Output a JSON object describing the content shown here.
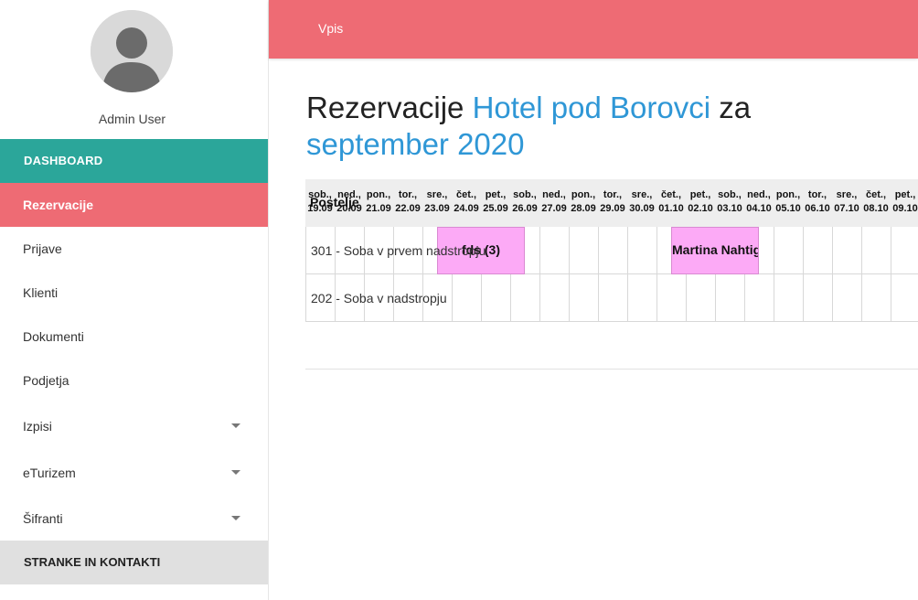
{
  "sidebar": {
    "user_name": "Admin User",
    "dashboard_label": "DASHBOARD",
    "items": [
      {
        "label": "Rezervacije"
      },
      {
        "label": "Prijave"
      },
      {
        "label": "Klienti"
      },
      {
        "label": "Dokumenti"
      },
      {
        "label": "Podjetja"
      },
      {
        "label": "Izpisi"
      },
      {
        "label": "eTurizem"
      },
      {
        "label": "Šifranti"
      }
    ],
    "section_label": "STRANKE IN KONTAKTI"
  },
  "topbar": {
    "link_label": "Vpis"
  },
  "title": {
    "prefix": "Rezervacije",
    "hotel": "Hotel pod Borovci",
    "connector": "za",
    "period": "september 2020"
  },
  "calendar": {
    "first_column_label": "Postelje",
    "days": [
      {
        "dow": "sob.,",
        "date": "19.09"
      },
      {
        "dow": "ned.,",
        "date": "20.09"
      },
      {
        "dow": "pon.,",
        "date": "21.09"
      },
      {
        "dow": "tor.,",
        "date": "22.09"
      },
      {
        "dow": "sre.,",
        "date": "23.09"
      },
      {
        "dow": "čet.,",
        "date": "24.09"
      },
      {
        "dow": "pet.,",
        "date": "25.09"
      },
      {
        "dow": "sob.,",
        "date": "26.09"
      },
      {
        "dow": "ned.,",
        "date": "27.09"
      },
      {
        "dow": "pon.,",
        "date": "28.09"
      },
      {
        "dow": "tor.,",
        "date": "29.09"
      },
      {
        "dow": "sre.,",
        "date": "30.09"
      },
      {
        "dow": "čet.,",
        "date": "01.10"
      },
      {
        "dow": "pet.,",
        "date": "02.10"
      },
      {
        "dow": "sob.,",
        "date": "03.10"
      },
      {
        "dow": "ned.,",
        "date": "04.10"
      },
      {
        "dow": "pon.,",
        "date": "05.10"
      },
      {
        "dow": "tor.,",
        "date": "06.10"
      },
      {
        "dow": "sre.,",
        "date": "07.10"
      },
      {
        "dow": "čet.,",
        "date": "08.10"
      },
      {
        "dow": "pet.,",
        "date": "09.10"
      }
    ],
    "rooms": [
      {
        "label": "301 - Soba v prvem nadstropju"
      },
      {
        "label": "202 - Soba v nadstropju"
      }
    ],
    "bookings": [
      {
        "room": 0,
        "start_day": 4.5,
        "end_day": 7.5,
        "label": "fds (3)"
      },
      {
        "room": 0,
        "start_day": 12.5,
        "end_day": 15.5,
        "label": "Martina Nahtigal"
      }
    ],
    "booking_color": "#fcaaf6"
  },
  "colors": {
    "accent_red": "#ee6b74",
    "accent_teal": "#2ba69a",
    "accent_blue": "#2f97d6"
  }
}
